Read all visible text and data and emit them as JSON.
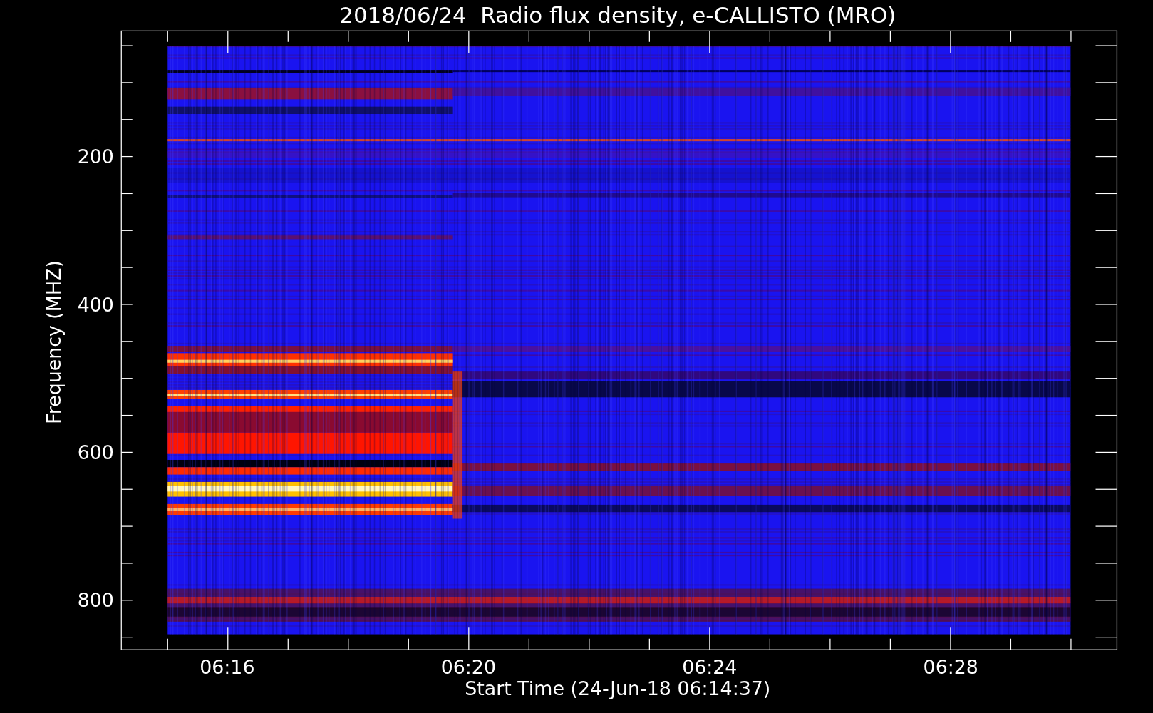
{
  "title": "2018/06/24  Radio flux density, e-CALLISTO (MRO)",
  "y_axis": {
    "label": "Frequency (MHZ)",
    "ticks": [
      "200",
      "400",
      "600",
      "800"
    ]
  },
  "x_axis": {
    "label": "Start Time (24-Jun-18 06:14:37)",
    "ticks": [
      "06:16",
      "06:20",
      "06:24",
      "06:28"
    ]
  }
}
